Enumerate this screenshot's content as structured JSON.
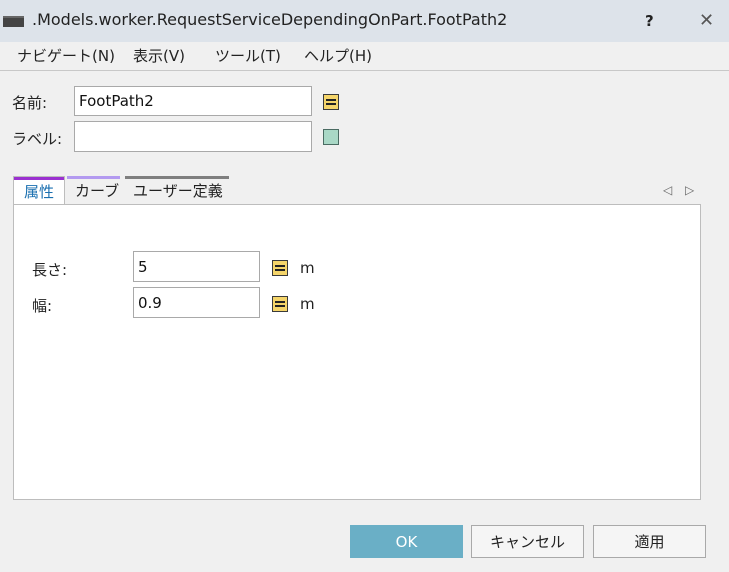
{
  "window": {
    "title": ".Models.worker.RequestServiceDependingOnPart.FootPath2",
    "help_label": "?",
    "close_label": "✕"
  },
  "menu": [
    {
      "label": "ナビゲート(N)"
    },
    {
      "label": "表示(V)"
    },
    {
      "label": "ツール(T)"
    },
    {
      "label": "ヘルプ(H)"
    }
  ],
  "form": {
    "name_label": "名前:",
    "name_value": "FootPath2",
    "label_label": "ラベル:",
    "label_value": ""
  },
  "tabs": [
    {
      "label": "属性",
      "active": true,
      "color": "#9b30d0"
    },
    {
      "label": "カーブ",
      "active": false,
      "color": "#b39af0"
    },
    {
      "label": "ユーザー定義",
      "active": false,
      "color": "#7f7f7f"
    }
  ],
  "tab_nav": {
    "prev": "◁",
    "next": "▷"
  },
  "attributes": [
    {
      "label": "長さ:",
      "value": "5",
      "unit": "m"
    },
    {
      "label": "幅:",
      "value": "0.9",
      "unit": "m"
    }
  ],
  "buttons": {
    "ok": "OK",
    "cancel": "キャンセル",
    "apply": "適用"
  },
  "colors": {
    "titlebar": "#dde3ea",
    "primary_button": "#6aafc6",
    "mode_button_formula": "#f5d56a",
    "mode_button_static": "#a9d8c6"
  }
}
